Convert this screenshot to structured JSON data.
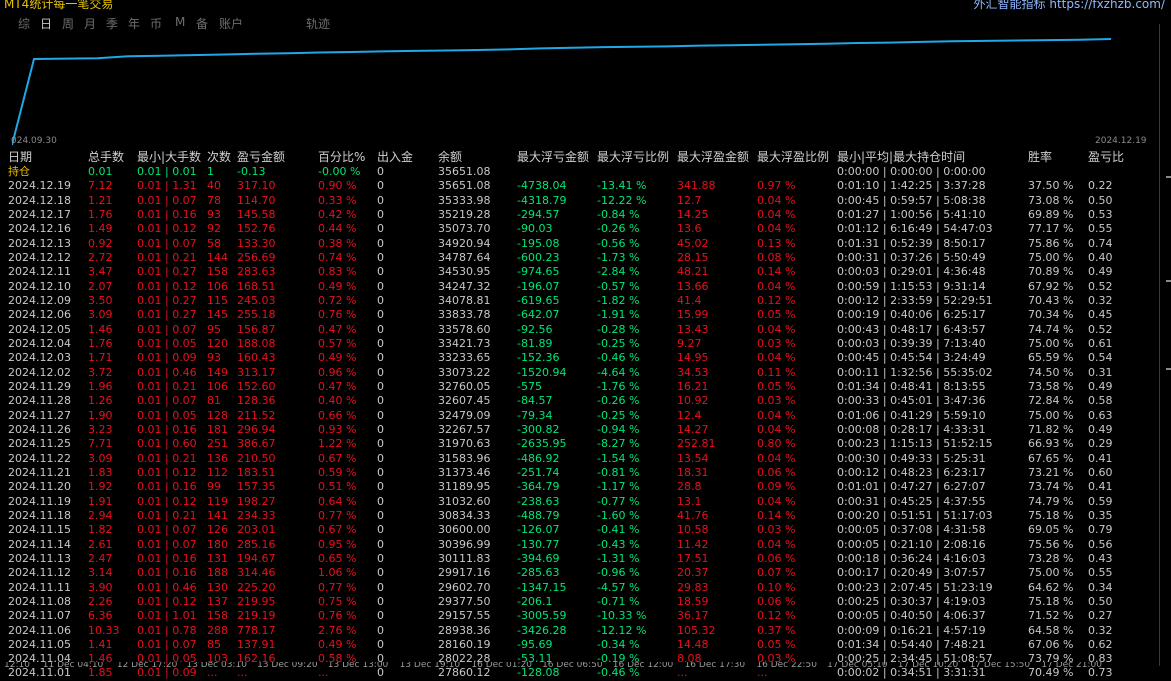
{
  "app": {
    "title": "MT4统计每一笔交易",
    "brand": "外汇智能指标 https://fxzhzb.com/"
  },
  "tabs": [
    "综",
    "日",
    "周",
    "月",
    "季",
    "年",
    "币",
    "M",
    "备",
    "账户",
    "轨迹"
  ],
  "active_tab": "日",
  "chart_data": {
    "type": "line",
    "x": [
      "2024.09.30",
      "2024.12.19"
    ],
    "xlabel_start": "024.09.30",
    "xlabel_end": "2024.12.19",
    "color": "#1ea8e8"
  },
  "table": {
    "headers": [
      "日期",
      "总手数",
      "最小|大手数",
      "次数",
      "盈亏金额",
      "百分比%",
      "出入金",
      "余额",
      "最大浮亏金额",
      "最大浮亏比例",
      "最大浮盈金额",
      "最大浮盈比例",
      "最小|平均|最大持仓时间",
      "胜率",
      "盈亏比"
    ],
    "holding": [
      "持仓",
      "0.01",
      "0.01 | 0.01",
      "1",
      "-0.13",
      "-0.00 %",
      "0",
      "35651.08",
      "",
      "",
      "",
      "",
      "0:00:00 | 0:00:00 | 0:00:00",
      "",
      ""
    ],
    "rows": [
      [
        "2024.12.19",
        "7.12",
        "0.01 | 1.31",
        "40",
        "317.10",
        "0.90 %",
        "0",
        "35651.08",
        "-4738.04",
        "-13.41 %",
        "341.88",
        "0.97 %",
        "0:01:10 | 1:42:25 | 3:37:28",
        "37.50 %",
        "0.22"
      ],
      [
        "2024.12.18",
        "1.21",
        "0.01 | 0.07",
        "78",
        "114.70",
        "0.33 %",
        "0",
        "35333.98",
        "-4318.79",
        "-12.22 %",
        "12.7",
        "0.04 %",
        "0:00:45 | 0:59:57 | 5:08:38",
        "73.08 %",
        "0.50"
      ],
      [
        "2024.12.17",
        "1.76",
        "0.01 | 0.16",
        "93",
        "145.58",
        "0.42 %",
        "0",
        "35219.28",
        "-294.57",
        "-0.84 %",
        "14.25",
        "0.04 %",
        "0:01:27 | 1:00:56 | 5:41:10",
        "69.89 %",
        "0.53"
      ],
      [
        "2024.12.16",
        "1.49",
        "0.01 | 0.12",
        "92",
        "152.76",
        "0.44 %",
        "0",
        "35073.70",
        "-90.03",
        "-0.26 %",
        "13.6",
        "0.04 %",
        "0:01:12 | 6:16:49 | 54:47:03",
        "77.17 %",
        "0.55"
      ],
      [
        "2024.12.13",
        "0.92",
        "0.01 | 0.07",
        "58",
        "133.30",
        "0.38 %",
        "0",
        "34920.94",
        "-195.08",
        "-0.56 %",
        "45.02",
        "0.13 %",
        "0:01:31 | 0:52:39 | 8:50:17",
        "75.86 %",
        "0.74"
      ],
      [
        "2024.12.12",
        "2.72",
        "0.01 | 0.21",
        "144",
        "256.69",
        "0.74 %",
        "0",
        "34787.64",
        "-600.23",
        "-1.73 %",
        "28.15",
        "0.08 %",
        "0:00:31 | 0:37:26 | 5:50:49",
        "75.00 %",
        "0.40"
      ],
      [
        "2024.12.11",
        "3.47",
        "0.01 | 0.27",
        "158",
        "283.63",
        "0.83 %",
        "0",
        "34530.95",
        "-974.65",
        "-2.84 %",
        "48.21",
        "0.14 %",
        "0:00:03 | 0:29:01 | 4:36:48",
        "70.89 %",
        "0.49"
      ],
      [
        "2024.12.10",
        "2.07",
        "0.01 | 0.12",
        "106",
        "168.51",
        "0.49 %",
        "0",
        "34247.32",
        "-196.07",
        "-0.57 %",
        "13.66",
        "0.04 %",
        "0:00:59 | 1:15:53 | 9:31:14",
        "67.92 %",
        "0.52"
      ],
      [
        "2024.12.09",
        "3.50",
        "0.01 | 0.27",
        "115",
        "245.03",
        "0.72 %",
        "0",
        "34078.81",
        "-619.65",
        "-1.82 %",
        "41.4",
        "0.12 %",
        "0:00:12 | 2:33:59 | 52:29:51",
        "70.43 %",
        "0.32"
      ],
      [
        "2024.12.06",
        "3.09",
        "0.01 | 0.27",
        "145",
        "255.18",
        "0.76 %",
        "0",
        "33833.78",
        "-642.07",
        "-1.91 %",
        "15.99",
        "0.05 %",
        "0:00:19 | 0:40:06 | 6:25:17",
        "70.34 %",
        "0.45"
      ],
      [
        "2024.12.05",
        "1.46",
        "0.01 | 0.07",
        "95",
        "156.87",
        "0.47 %",
        "0",
        "33578.60",
        "-92.56",
        "-0.28 %",
        "13.43",
        "0.04 %",
        "0:00:43 | 0:48:17 | 6:43:57",
        "74.74 %",
        "0.52"
      ],
      [
        "2024.12.04",
        "1.76",
        "0.01 | 0.05",
        "120",
        "188.08",
        "0.57 %",
        "0",
        "33421.73",
        "-81.89",
        "-0.25 %",
        "9.27",
        "0.03 %",
        "0:00:03 | 0:39:39 | 7:13:40",
        "75.00 %",
        "0.61"
      ],
      [
        "2024.12.03",
        "1.71",
        "0.01 | 0.09",
        "93",
        "160.43",
        "0.49 %",
        "0",
        "33233.65",
        "-152.36",
        "-0.46 %",
        "14.95",
        "0.04 %",
        "0:00:45 | 0:45:54 | 3:24:49",
        "65.59 %",
        "0.54"
      ],
      [
        "2024.12.02",
        "3.72",
        "0.01 | 0.46",
        "149",
        "313.17",
        "0.96 %",
        "0",
        "33073.22",
        "-1520.94",
        "-4.64 %",
        "34.53",
        "0.11 %",
        "0:00:11 | 1:32:56 | 55:35:02",
        "74.50 %",
        "0.31"
      ],
      [
        "2024.11.29",
        "1.96",
        "0.01 | 0.21",
        "106",
        "152.60",
        "0.47 %",
        "0",
        "32760.05",
        "-575",
        "-1.76 %",
        "16.21",
        "0.05 %",
        "0:01:34 | 0:48:41 | 8:13:55",
        "73.58 %",
        "0.49"
      ],
      [
        "2024.11.28",
        "1.26",
        "0.01 | 0.07",
        "81",
        "128.36",
        "0.40 %",
        "0",
        "32607.45",
        "-84.57",
        "-0.26 %",
        "10.92",
        "0.03 %",
        "0:00:33 | 0:45:01 | 3:47:36",
        "72.84 %",
        "0.58"
      ],
      [
        "2024.11.27",
        "1.90",
        "0.01 | 0.05",
        "128",
        "211.52",
        "0.66 %",
        "0",
        "32479.09",
        "-79.34",
        "-0.25 %",
        "12.4",
        "0.04 %",
        "0:01:06 | 0:41:29 | 5:59:10",
        "75.00 %",
        "0.63"
      ],
      [
        "2024.11.26",
        "3.23",
        "0.01 | 0.16",
        "181",
        "296.94",
        "0.93 %",
        "0",
        "32267.57",
        "-300.82",
        "-0.94 %",
        "14.27",
        "0.04 %",
        "0:00:08 | 0:28:17 | 4:33:31",
        "71.82 %",
        "0.49"
      ],
      [
        "2024.11.25",
        "7.71",
        "0.01 | 0.60",
        "251",
        "386.67",
        "1.22 %",
        "0",
        "31970.63",
        "-2635.95",
        "-8.27 %",
        "252.81",
        "0.80 %",
        "0:00:23 | 1:15:13 | 51:52:15",
        "66.93 %",
        "0.29"
      ],
      [
        "2024.11.22",
        "3.09",
        "0.01 | 0.21",
        "136",
        "210.50",
        "0.67 %",
        "0",
        "31583.96",
        "-486.92",
        "-1.54 %",
        "13.54",
        "0.04 %",
        "0:00:30 | 0:49:33 | 5:25:31",
        "67.65 %",
        "0.41"
      ],
      [
        "2024.11.21",
        "1.83",
        "0.01 | 0.12",
        "112",
        "183.51",
        "0.59 %",
        "0",
        "31373.46",
        "-251.74",
        "-0.81 %",
        "18.31",
        "0.06 %",
        "0:00:12 | 0:48:23 | 6:23:17",
        "73.21 %",
        "0.60"
      ],
      [
        "2024.11.20",
        "1.92",
        "0.01 | 0.16",
        "99",
        "157.35",
        "0.51 %",
        "0",
        "31189.95",
        "-364.79",
        "-1.17 %",
        "28.8",
        "0.09 %",
        "0:01:01 | 0:47:27 | 6:27:07",
        "73.74 %",
        "0.41"
      ],
      [
        "2024.11.19",
        "1.91",
        "0.01 | 0.12",
        "119",
        "198.27",
        "0.64 %",
        "0",
        "31032.60",
        "-238.63",
        "-0.77 %",
        "13.1",
        "0.04 %",
        "0:00:31 | 0:45:25 | 4:37:55",
        "74.79 %",
        "0.59"
      ],
      [
        "2024.11.18",
        "2.94",
        "0.01 | 0.21",
        "141",
        "234.33",
        "0.77 %",
        "0",
        "30834.33",
        "-488.79",
        "-1.60 %",
        "41.76",
        "0.14 %",
        "0:00:20 | 0:51:51 | 51:17:03",
        "75.18 %",
        "0.35"
      ],
      [
        "2024.11.15",
        "1.82",
        "0.01 | 0.07",
        "126",
        "203.01",
        "0.67 %",
        "0",
        "30600.00",
        "-126.07",
        "-0.41 %",
        "10.58",
        "0.03 %",
        "0:00:05 | 0:37:08 | 4:31:58",
        "69.05 %",
        "0.79"
      ],
      [
        "2024.11.14",
        "2.61",
        "0.01 | 0.07",
        "180",
        "285.16",
        "0.95 %",
        "0",
        "30396.99",
        "-130.77",
        "-0.43 %",
        "11.42",
        "0.04 %",
        "0:00:05 | 0:21:10 | 2:08:16",
        "75.56 %",
        "0.56"
      ],
      [
        "2024.11.13",
        "2.47",
        "0.01 | 0.16",
        "131",
        "194.67",
        "0.65 %",
        "0",
        "30111.83",
        "-394.69",
        "-1.31 %",
        "17.51",
        "0.06 %",
        "0:00:18 | 0:36:24 | 4:16:03",
        "73.28 %",
        "0.43"
      ],
      [
        "2024.11.12",
        "3.14",
        "0.01 | 0.16",
        "188",
        "314.46",
        "1.06 %",
        "0",
        "29917.16",
        "-285.63",
        "-0.96 %",
        "20.37",
        "0.07 %",
        "0:00:17 | 0:20:49 | 3:07:57",
        "75.00 %",
        "0.55"
      ],
      [
        "2024.11.11",
        "3.90",
        "0.01 | 0.46",
        "130",
        "225.20",
        "0.77 %",
        "0",
        "29602.70",
        "-1347.15",
        "-4.57 %",
        "29.83",
        "0.10 %",
        "0:00:23 | 2:07:45 | 51:23:19",
        "64.62 %",
        "0.34"
      ],
      [
        "2024.11.08",
        "2.26",
        "0.01 | 0.12",
        "137",
        "219.95",
        "0.75 %",
        "0",
        "29377.50",
        "-206.1",
        "-0.71 %",
        "18.59",
        "0.06 %",
        "0:00:25 | 0:30:37 | 4:19:03",
        "75.18 %",
        "0.50"
      ],
      [
        "2024.11.07",
        "6.36",
        "0.01 | 1.01",
        "158",
        "219.19",
        "0.76 %",
        "0",
        "29157.55",
        "-3005.59",
        "-10.33 %",
        "36.17",
        "0.12 %",
        "0:00:05 | 0:40:50 | 4:06:37",
        "71.52 %",
        "0.27"
      ],
      [
        "2024.11.06",
        "10.33",
        "0.01 | 0.78",
        "288",
        "778.17",
        "2.76 %",
        "0",
        "28938.36",
        "-3426.28",
        "-12.12 %",
        "105.32",
        "0.37 %",
        "0:00:09 | 0:16:21 | 4:57:19",
        "64.58 %",
        "0.32"
      ],
      [
        "2024.11.05",
        "1.41",
        "0.01 | 0.07",
        "85",
        "137.91",
        "0.49 %",
        "0",
        "28160.19",
        "-95.69",
        "-0.34 %",
        "14.48",
        "0.05 %",
        "0:01:34 | 0:54:40 | 7:48:21",
        "67.06 %",
        "0.62"
      ],
      [
        "2024.11.04",
        "1.46",
        "0.01 | 0.05",
        "103",
        "162.16",
        "0.58 %",
        "0",
        "28022.28",
        "-53.11",
        "-0.19 %",
        "8.08",
        "0.03 %",
        "0:00:25 | 2:34:45 | 51:08:57",
        "73.79 %",
        "0.83"
      ],
      [
        "2024.11.01",
        "1.85",
        "0.01 | 0.09",
        "...",
        "...",
        "...",
        "0",
        "27860.12",
        "-128.08",
        "-0.46 %",
        "...",
        "...",
        "0:00:02 | 0:34:51 | 3:31:31",
        "70.49 %",
        "0.73"
      ]
    ]
  },
  "bottom_dates": [
    "12:10",
    "11 Dec 04:10",
    "12 Dec 17:20",
    "13 Dec 03:10",
    "13 Dec 09:20",
    "13 Dec 13:00",
    "13 Dec 19:10",
    "16 Dec 01:20",
    "16 Dec 06:50",
    "16 Dec 12:00",
    "16 Dec 17:30",
    "16 Dec 22:50",
    "17 Dec 05:10",
    "17 Dec 10:20",
    "17 Dec 15:50",
    "17 Dec 21:00"
  ]
}
